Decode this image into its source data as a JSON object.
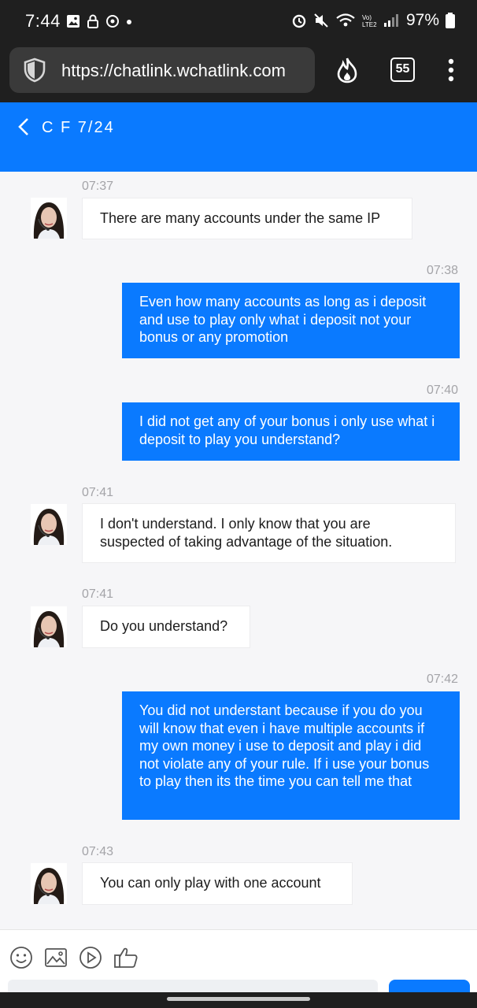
{
  "status_bar": {
    "time": "7:44",
    "battery": "97%"
  },
  "browser": {
    "url": "https://chatlink.wchatlink.com",
    "tab_count": "55"
  },
  "header": {
    "title": "C F 7/24"
  },
  "messages": [
    {
      "direction": "in",
      "time": "07:37",
      "text": "There are many accounts under the same IP"
    },
    {
      "direction": "out",
      "time": "07:38",
      "text": "Even how many accounts as long as i deposit and use to play only what i deposit not your bonus or any promotion"
    },
    {
      "direction": "out",
      "time": "07:40",
      "text": "I did not get any of your bonus i only use what i deposit to play you understand?"
    },
    {
      "direction": "in",
      "time": "07:41",
      "text": "I don't understand. I only know that you are suspected of taking advantage of the situation."
    },
    {
      "direction": "in",
      "time": "07:41",
      "text": "Do you understand?"
    },
    {
      "direction": "out",
      "time": "07:42",
      "text": "You did not understant because if you do you will know that even i have multiple accounts if my own money i use to deposit and play i did not violate any of your rule. If i use your bonus to play then its the time you can tell me that"
    },
    {
      "direction": "in",
      "time": "07:43",
      "text": "You can only play with one account"
    }
  ],
  "toolbar": {
    "icons": [
      "emoji-icon",
      "image-icon",
      "video-icon",
      "thumbs-up-icon"
    ]
  },
  "colors": {
    "accent": "#0a7aff",
    "status_bar": "#1f1f1f",
    "chat_bg": "#f6f6f8"
  }
}
